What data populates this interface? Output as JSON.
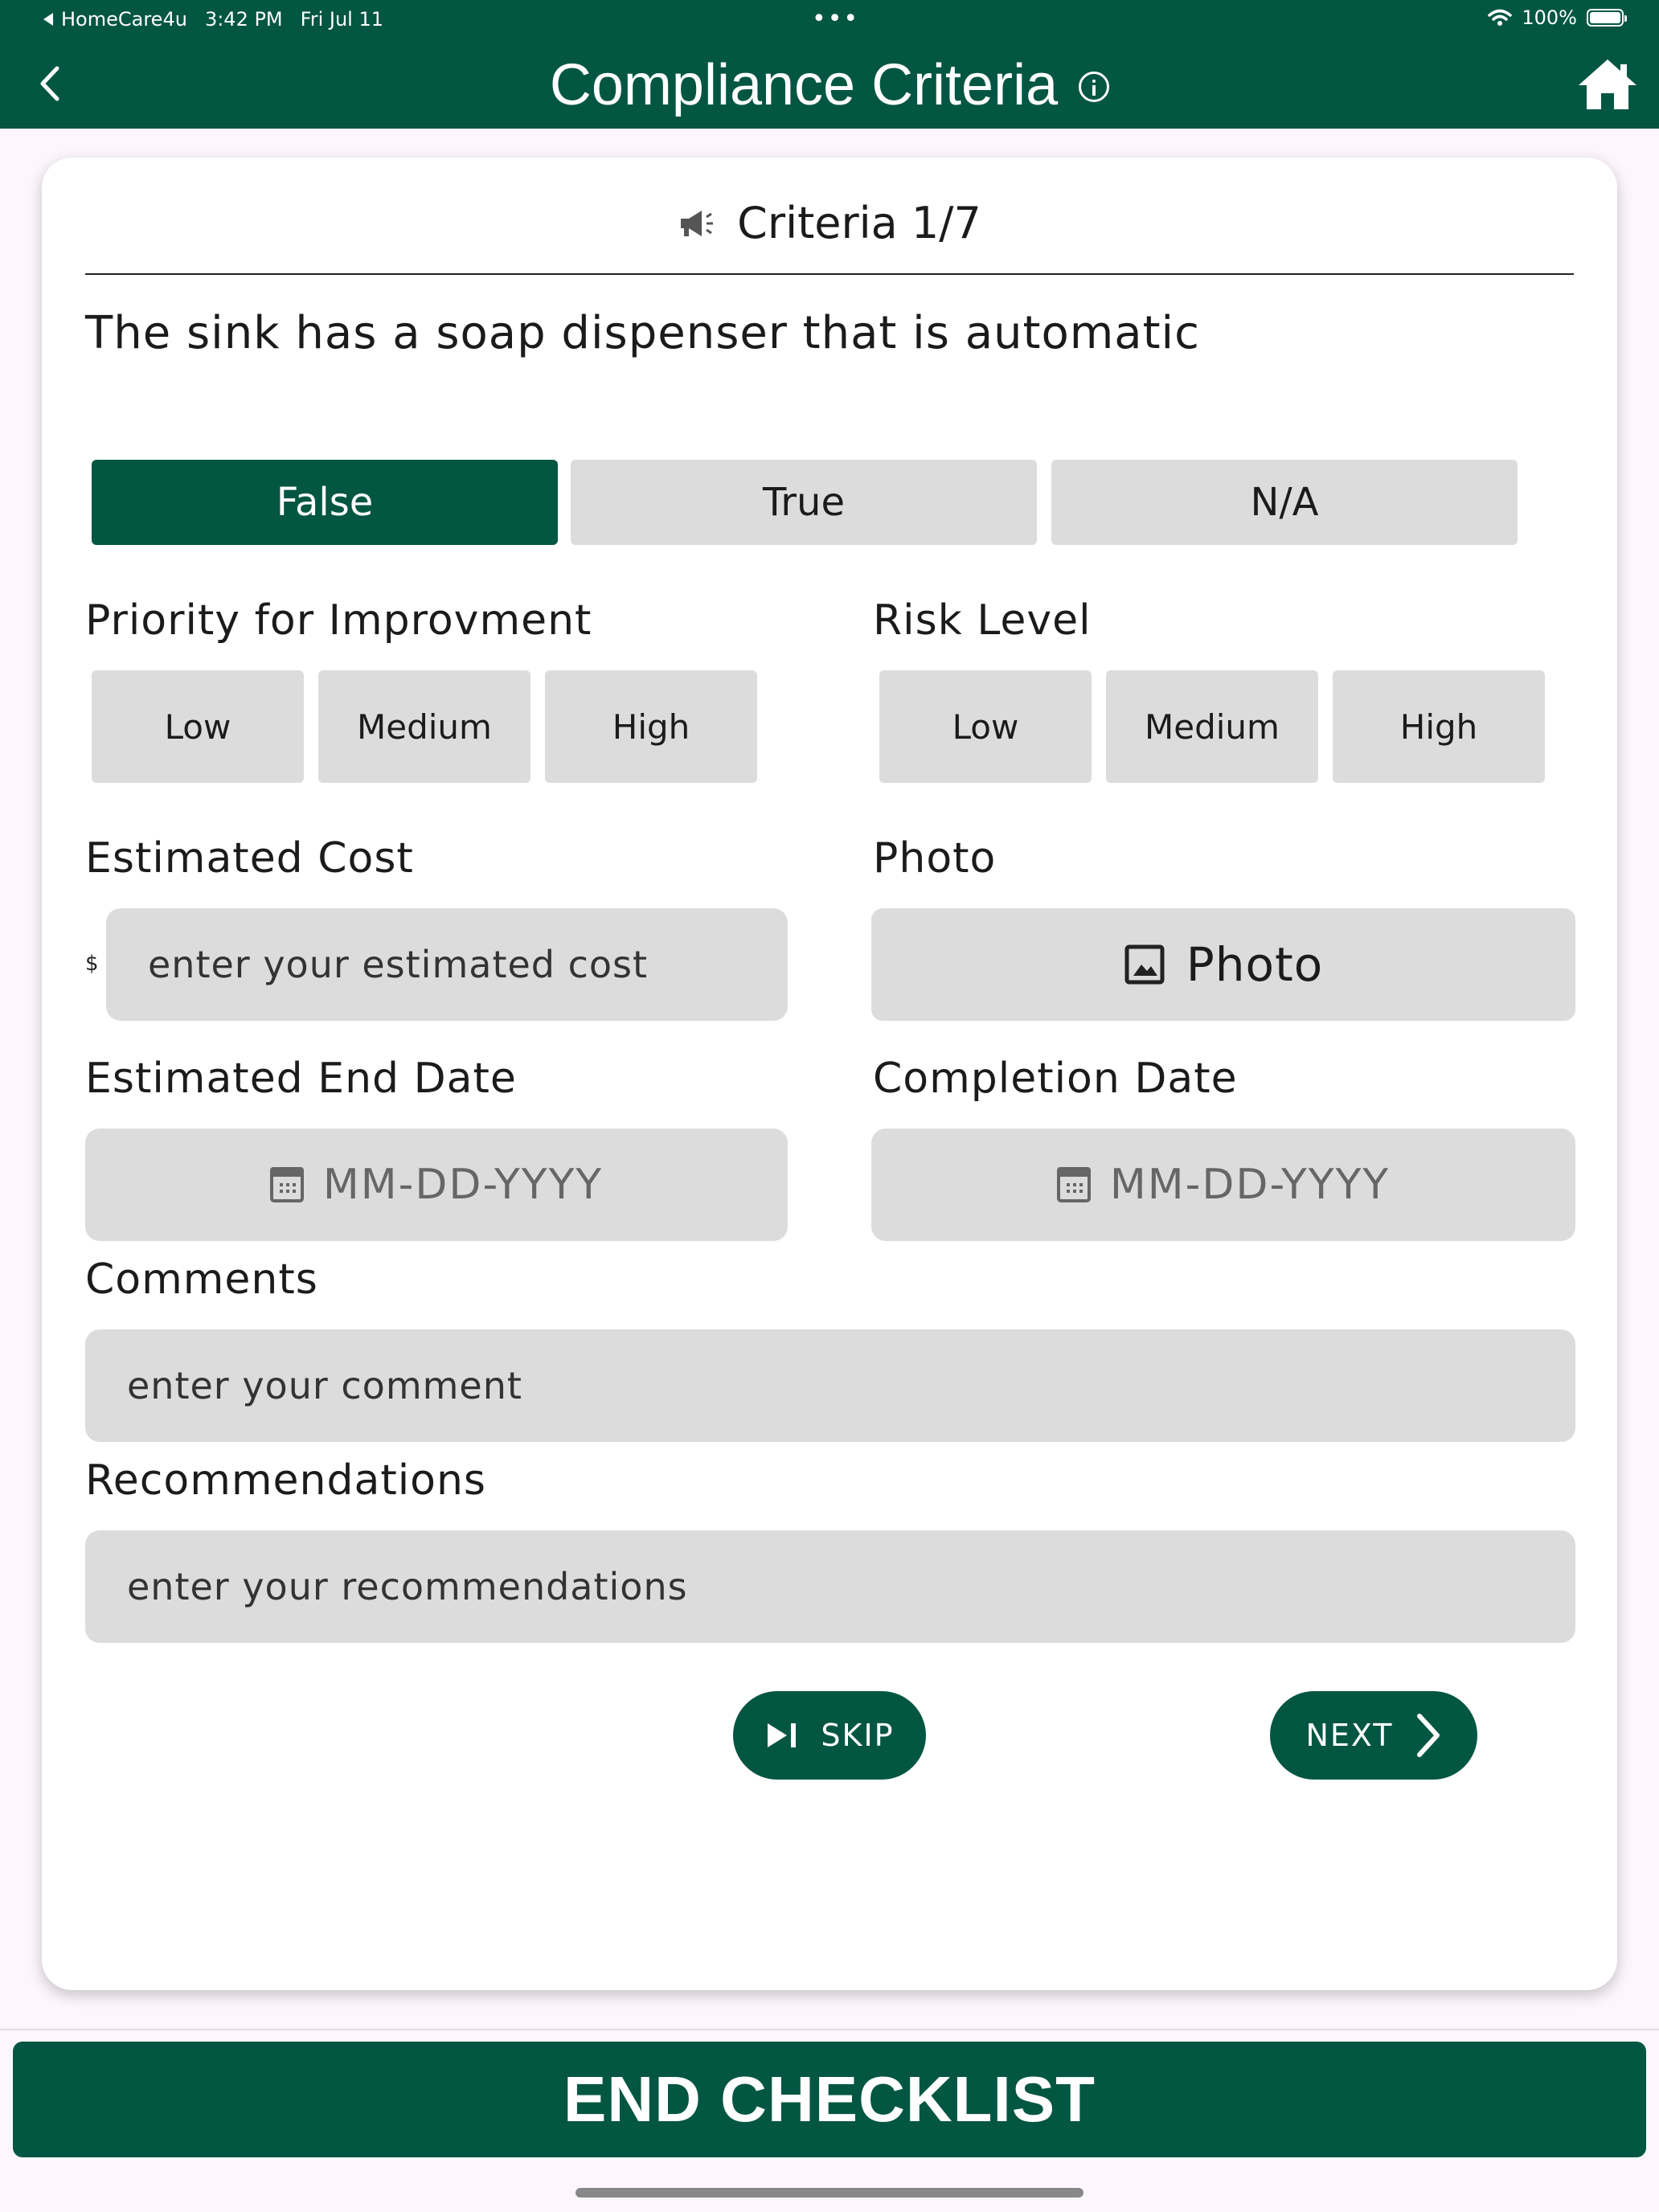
{
  "status_bar": {
    "back_app": "HomeCare4u",
    "time": "3:42 PM",
    "date": "Fri Jul 11",
    "battery": "100%"
  },
  "header": {
    "title": "Compliance Criteria",
    "back_icon": "chevron-left-icon",
    "info_icon": "info-icon",
    "home_icon": "home-icon"
  },
  "criteria": {
    "label": "Criteria 1/7",
    "question": "The sink has a soap dispenser that is automatic"
  },
  "answer_options": [
    {
      "label": "False",
      "selected": true
    },
    {
      "label": "True",
      "selected": false
    },
    {
      "label": "N/A",
      "selected": false
    }
  ],
  "priority": {
    "label": "Priority for Improvment",
    "options": [
      "Low",
      "Medium",
      "High"
    ]
  },
  "risk": {
    "label": "Risk Level",
    "options": [
      "Low",
      "Medium",
      "High"
    ]
  },
  "cost": {
    "label": "Estimated Cost",
    "currency": "$",
    "placeholder": "enter your estimated cost"
  },
  "photo": {
    "label": "Photo",
    "button_label": "Photo"
  },
  "end_date": {
    "label": "Estimated End Date",
    "placeholder": "MM-DD-YYYY"
  },
  "completion_date": {
    "label": "Completion Date",
    "placeholder": "MM-DD-YYYY"
  },
  "comments": {
    "label": "Comments",
    "placeholder": "enter your comment"
  },
  "recommendations": {
    "label": "Recommendations",
    "placeholder": "enter your recommendations"
  },
  "actions": {
    "skip": "SKIP",
    "next": "NEXT",
    "end": "END CHECKLIST"
  },
  "colors": {
    "primary": "#035642",
    "field_bg": "#dcdcdc"
  }
}
